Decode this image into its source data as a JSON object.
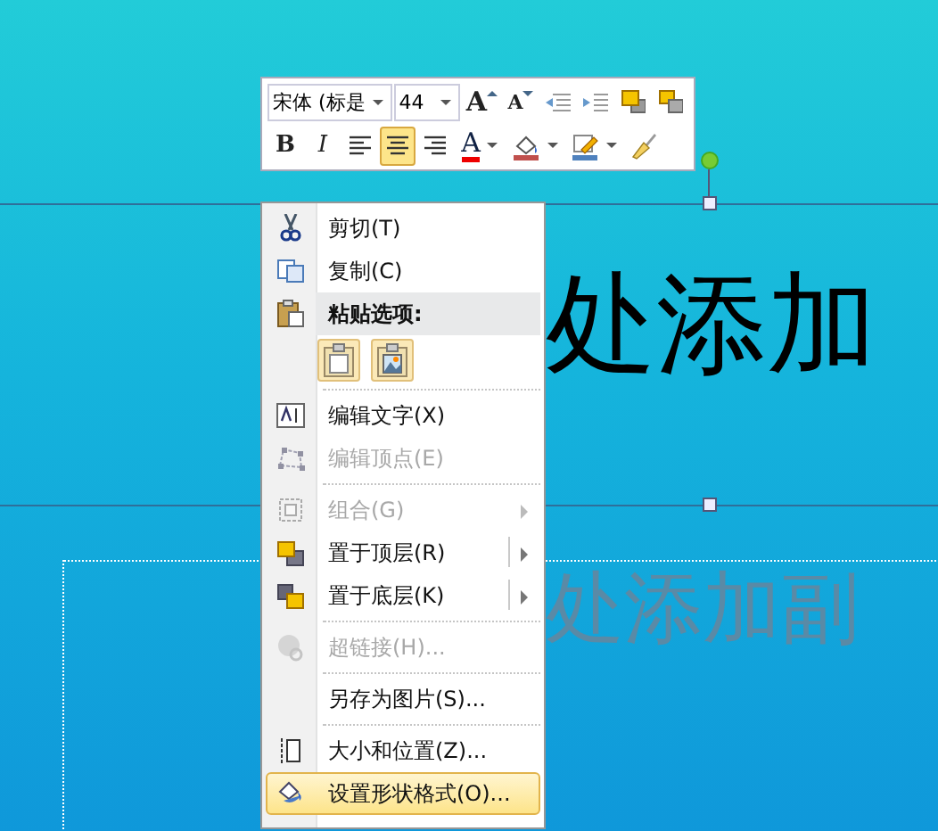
{
  "slide": {
    "title": "处添加",
    "subtitle": "处添加副"
  },
  "mini_toolbar": {
    "font": "宋体 (标是",
    "size": "44",
    "row1": [
      {
        "kind": "grow",
        "glyph": "A"
      },
      {
        "kind": "shrink",
        "glyph": "A"
      },
      {
        "kind": "outdent"
      },
      {
        "kind": "indent"
      },
      {
        "kind": "front"
      },
      {
        "kind": "back"
      }
    ],
    "row2": [
      {
        "kind": "bold",
        "glyph": "B",
        "selected": false
      },
      {
        "kind": "italic",
        "glyph": "I",
        "selected": false
      },
      {
        "kind": "align-left",
        "selected": false
      },
      {
        "kind": "align-center",
        "selected": true
      },
      {
        "kind": "align-right",
        "selected": false
      },
      {
        "kind": "font-color",
        "glyph": "A",
        "selected": false
      },
      {
        "kind": "fill",
        "selected": false
      },
      {
        "kind": "outline",
        "selected": false
      },
      {
        "kind": "painter",
        "selected": false
      }
    ]
  },
  "context_menu": [
    {
      "kind": "item",
      "label": "剪切(T)",
      "disabled": false,
      "submenu": false,
      "selected": false
    },
    {
      "kind": "item",
      "label": "复制(C)",
      "disabled": false,
      "submenu": false,
      "selected": false
    },
    {
      "kind": "header",
      "label": "粘贴选项:"
    },
    {
      "kind": "paste-options"
    },
    {
      "kind": "separator"
    },
    {
      "kind": "item",
      "label": "编辑文字(X)",
      "disabled": false,
      "submenu": false,
      "selected": false
    },
    {
      "kind": "item",
      "label": "编辑顶点(E)",
      "disabled": true,
      "submenu": false,
      "selected": false
    },
    {
      "kind": "separator"
    },
    {
      "kind": "item",
      "label": "组合(G)",
      "disabled": true,
      "submenu": true,
      "selected": false
    },
    {
      "kind": "item",
      "label": "置于顶层(R)",
      "disabled": false,
      "submenu": true,
      "selected": false
    },
    {
      "kind": "item",
      "label": "置于底层(K)",
      "disabled": false,
      "submenu": true,
      "selected": false
    },
    {
      "kind": "separator"
    },
    {
      "kind": "item",
      "label": "超链接(H)...",
      "disabled": true,
      "submenu": false,
      "selected": false
    },
    {
      "kind": "separator"
    },
    {
      "kind": "item",
      "label": "另存为图片(S)...",
      "disabled": false,
      "submenu": false,
      "selected": false
    },
    {
      "kind": "separator"
    },
    {
      "kind": "item",
      "label": "大小和位置(Z)...",
      "disabled": false,
      "submenu": false,
      "selected": false
    },
    {
      "kind": "item",
      "label": "设置形状格式(O)...",
      "disabled": false,
      "submenu": false,
      "selected": true
    }
  ]
}
